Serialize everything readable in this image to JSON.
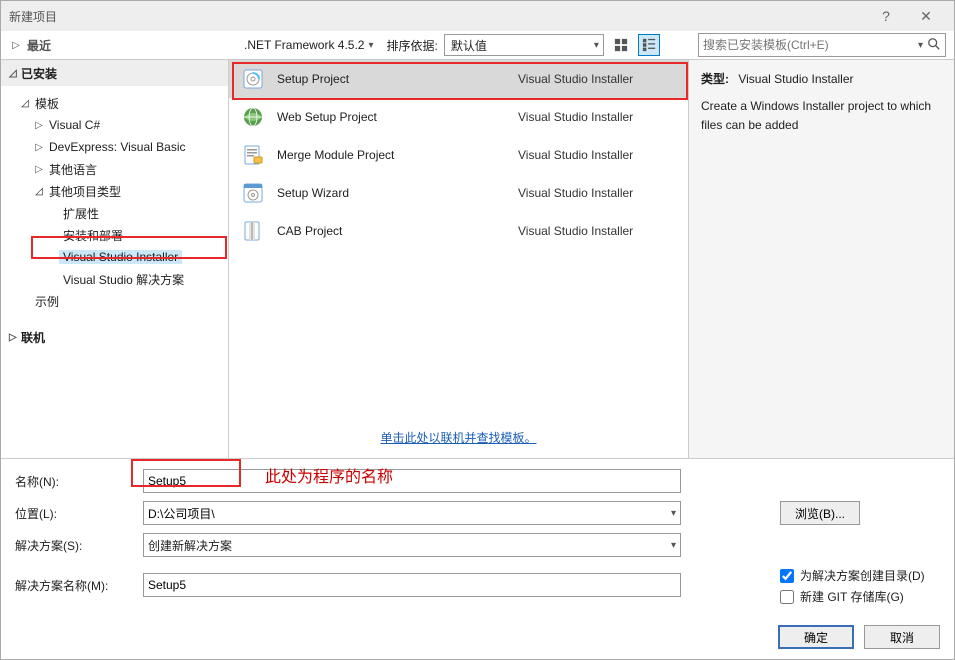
{
  "window": {
    "title": "新建项目"
  },
  "toolbar": {
    "recent_label": "最近",
    "framework_label": ".NET Framework 4.5.2",
    "sort_label": "排序依据:",
    "sort_value": "默认值",
    "search_placeholder": "搜索已安装模板(Ctrl+E)"
  },
  "sidebar": {
    "installed_label": "已安装",
    "templates_label": "模板",
    "items": [
      {
        "label": "Visual C#"
      },
      {
        "label": "DevExpress: Visual Basic"
      },
      {
        "label": "其他语言"
      },
      {
        "label": "其他项目类型"
      }
    ],
    "subitems": [
      {
        "label": "扩展性"
      },
      {
        "label": "安装和部署"
      },
      {
        "label": "Visual Studio Installer"
      },
      {
        "label": "Visual Studio 解决方案"
      }
    ],
    "sample_label": "示例",
    "online_label": "联机"
  },
  "templates": [
    {
      "name": "Setup Project",
      "cat": "Visual Studio Installer"
    },
    {
      "name": "Web Setup Project",
      "cat": "Visual Studio Installer"
    },
    {
      "name": "Merge Module Project",
      "cat": "Visual Studio Installer"
    },
    {
      "name": "Setup Wizard",
      "cat": "Visual Studio Installer"
    },
    {
      "name": "CAB Project",
      "cat": "Visual Studio Installer"
    }
  ],
  "footer_link": "单击此处以联机并查找模板。",
  "desc": {
    "type_label": "类型:",
    "type_value": "Visual Studio Installer",
    "body": "Create a Windows Installer project to which files can be added"
  },
  "form": {
    "name_label": "名称(N):",
    "name_value": "Setup5",
    "loc_label": "位置(L):",
    "loc_value": "D:\\公司项目\\",
    "sol_label": "解决方案(S):",
    "sol_value": "创建新解决方案",
    "solname_label": "解决方案名称(M):",
    "solname_value": "Setup5",
    "browse_label": "浏览(B)...",
    "chk1_label": "为解决方案创建目录(D)",
    "chk2_label": "新建 GIT 存储库(G)"
  },
  "annotation": "此处为程序的名称",
  "buttons": {
    "ok": "确定",
    "cancel": "取消"
  }
}
